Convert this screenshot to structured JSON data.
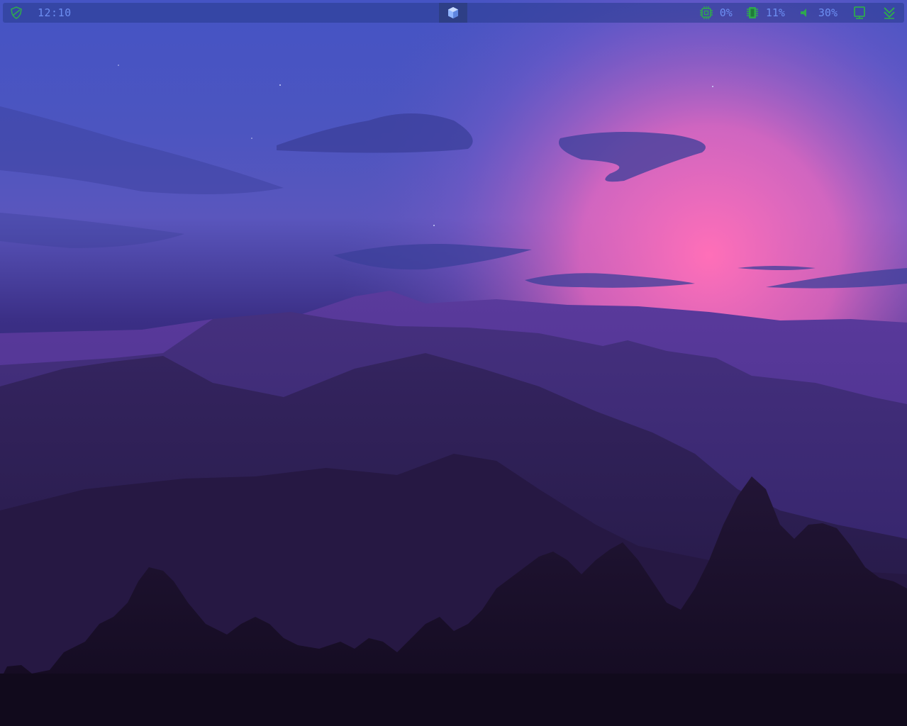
{
  "topbar": {
    "clock": "12:10",
    "cpu": "0%",
    "memory": "11%",
    "volume": "30%"
  },
  "icons": {
    "security": "shield-icon",
    "workspace": "cube-icon",
    "cpu": "cpu-chip-icon",
    "memory": "memory-icon",
    "volume": "speaker-icon",
    "display": "monitor-icon",
    "menu": "chevrons-down-icon"
  },
  "colors": {
    "accent_text": "#6d8ef2",
    "icon_green": "#2fa84f",
    "bar_bg": "#283a8c"
  }
}
